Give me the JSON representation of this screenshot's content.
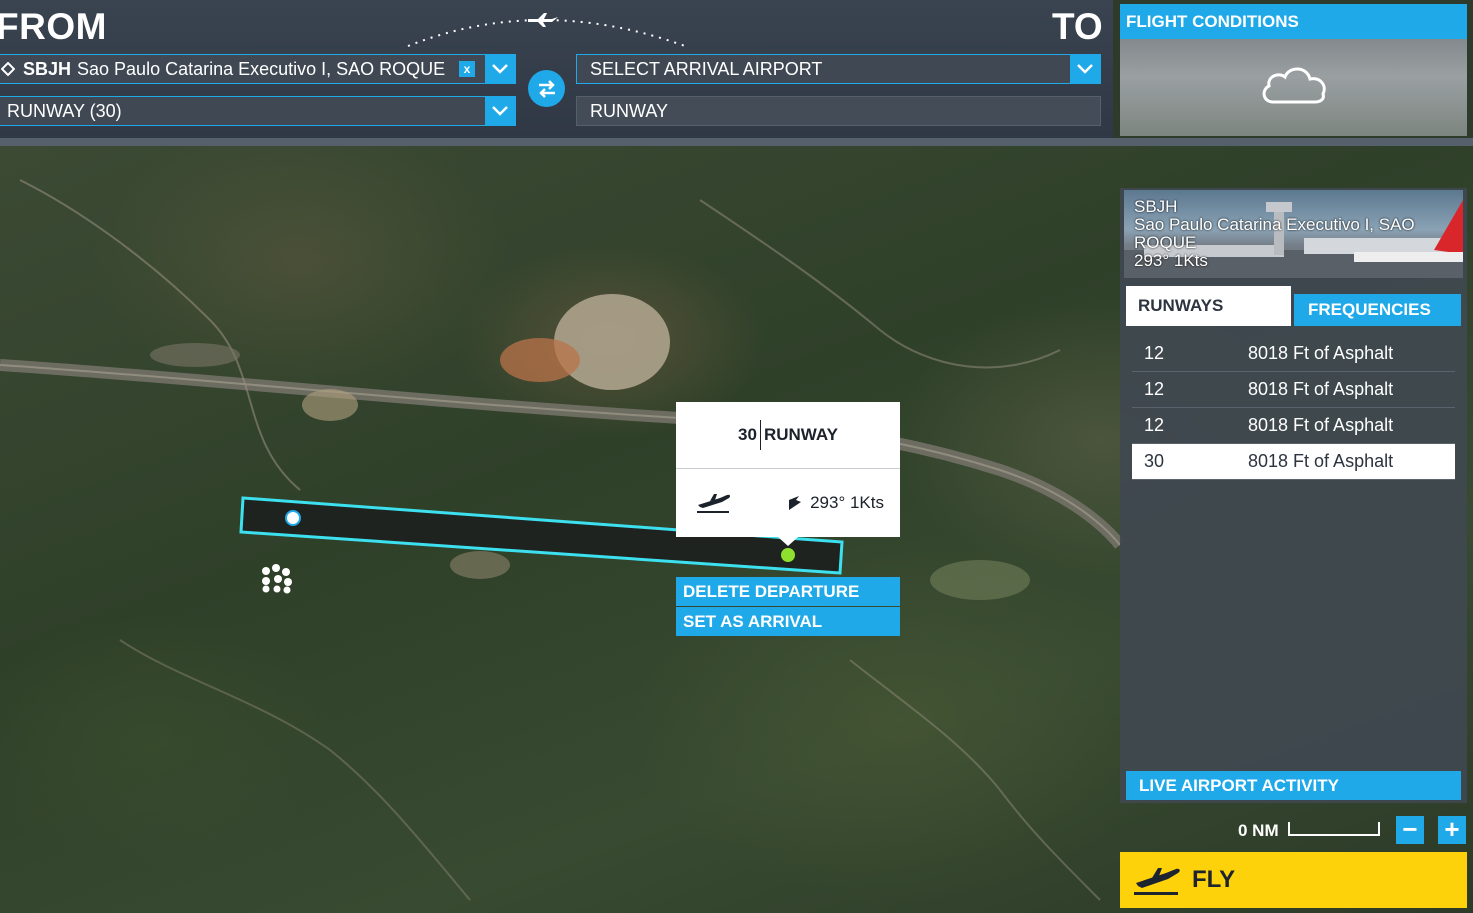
{
  "header": {
    "from_title": "FROM",
    "to_title": "TO",
    "departure": {
      "icao": "SBJH",
      "name": "Sao Paulo Catarina Executivo I, SAO ROQUE",
      "clear_label": "x"
    },
    "departure_runway": "RUNWAY (30)",
    "arrival": {
      "placeholder": "SELECT ARRIVAL AIRPORT"
    },
    "arrival_runway": "RUNWAY"
  },
  "conditions": {
    "title": "FLIGHT CONDITIONS",
    "weather_icon": "cloud-icon"
  },
  "airport_panel": {
    "icao": "SBJH",
    "name": "Sao Paulo Catarina Executivo I, SAO ROQUE",
    "wind": "293° 1Kts",
    "tabs": {
      "runways": "RUNWAYS",
      "frequencies": "FREQUENCIES"
    },
    "runways": [
      {
        "number": "12",
        "desc": "8018 Ft of Asphalt",
        "selected": false
      },
      {
        "number": "12",
        "desc": "8018 Ft of Asphalt",
        "selected": false
      },
      {
        "number": "12",
        "desc": "8018 Ft of Asphalt",
        "selected": false
      },
      {
        "number": "30",
        "desc": "8018 Ft of Asphalt",
        "selected": true
      }
    ],
    "live_activity": "LIVE AIRPORT ACTIVITY"
  },
  "popup": {
    "runway_number": "30",
    "runway_label": "RUNWAY",
    "wind": "293° 1Kts",
    "actions": {
      "delete": "DELETE DEPARTURE",
      "set_arrival": "SET AS ARRIVAL"
    }
  },
  "map": {
    "scale_label": "0 NM",
    "zoom_out": "−",
    "zoom_in": "+"
  },
  "fly": {
    "label": "FLY"
  },
  "colors": {
    "accent": "#1fa9e8",
    "fly": "#fdd20a",
    "runway_outline": "#3de0ee",
    "threshold_dot": "#8fe02e"
  }
}
